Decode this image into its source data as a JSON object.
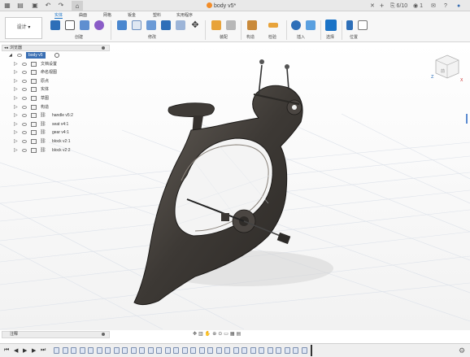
{
  "title_bar": {
    "document_title": "body v5*",
    "version_count": "6/10",
    "notification_count": "1"
  },
  "ribbon": {
    "workspace_label": "设计",
    "tabs": [
      "实体",
      "曲面",
      "网格",
      "钣金",
      "塑料",
      "实用程序"
    ],
    "active_tab": "实体",
    "groups": [
      "创建",
      "修改",
      "装配",
      "构造",
      "检验",
      "插入",
      "选择",
      "位置"
    ]
  },
  "browser": {
    "header": "浏览器",
    "root": "body v5",
    "items": [
      {
        "label": "文档设置",
        "type": "folder"
      },
      {
        "label": "命名视图",
        "type": "folder"
      },
      {
        "label": "原点",
        "type": "folder"
      },
      {
        "label": "实体",
        "type": "folder"
      },
      {
        "label": "草图",
        "type": "folder"
      },
      {
        "label": "构造",
        "type": "folder"
      },
      {
        "label": "handle v5:2",
        "type": "component"
      },
      {
        "label": "seat v4:1",
        "type": "component"
      },
      {
        "label": "gear v4:1",
        "type": "component"
      },
      {
        "label": "block v2:1",
        "type": "component"
      },
      {
        "label": "block v2:2",
        "type": "component"
      }
    ]
  },
  "viewcube": {
    "front_label": "前",
    "axis_x": "X",
    "axis_z": "Z"
  },
  "comments": {
    "label": "注释"
  },
  "colors": {
    "accent": "#1a73c7",
    "model": "#4a4540",
    "selection": "#3a6fb3"
  },
  "icons": [
    "grid-icon",
    "file-icon",
    "save-icon",
    "undo-icon",
    "redo-icon",
    "home-icon",
    "close-icon",
    "plus-icon",
    "gear-icon",
    "help-icon"
  ]
}
